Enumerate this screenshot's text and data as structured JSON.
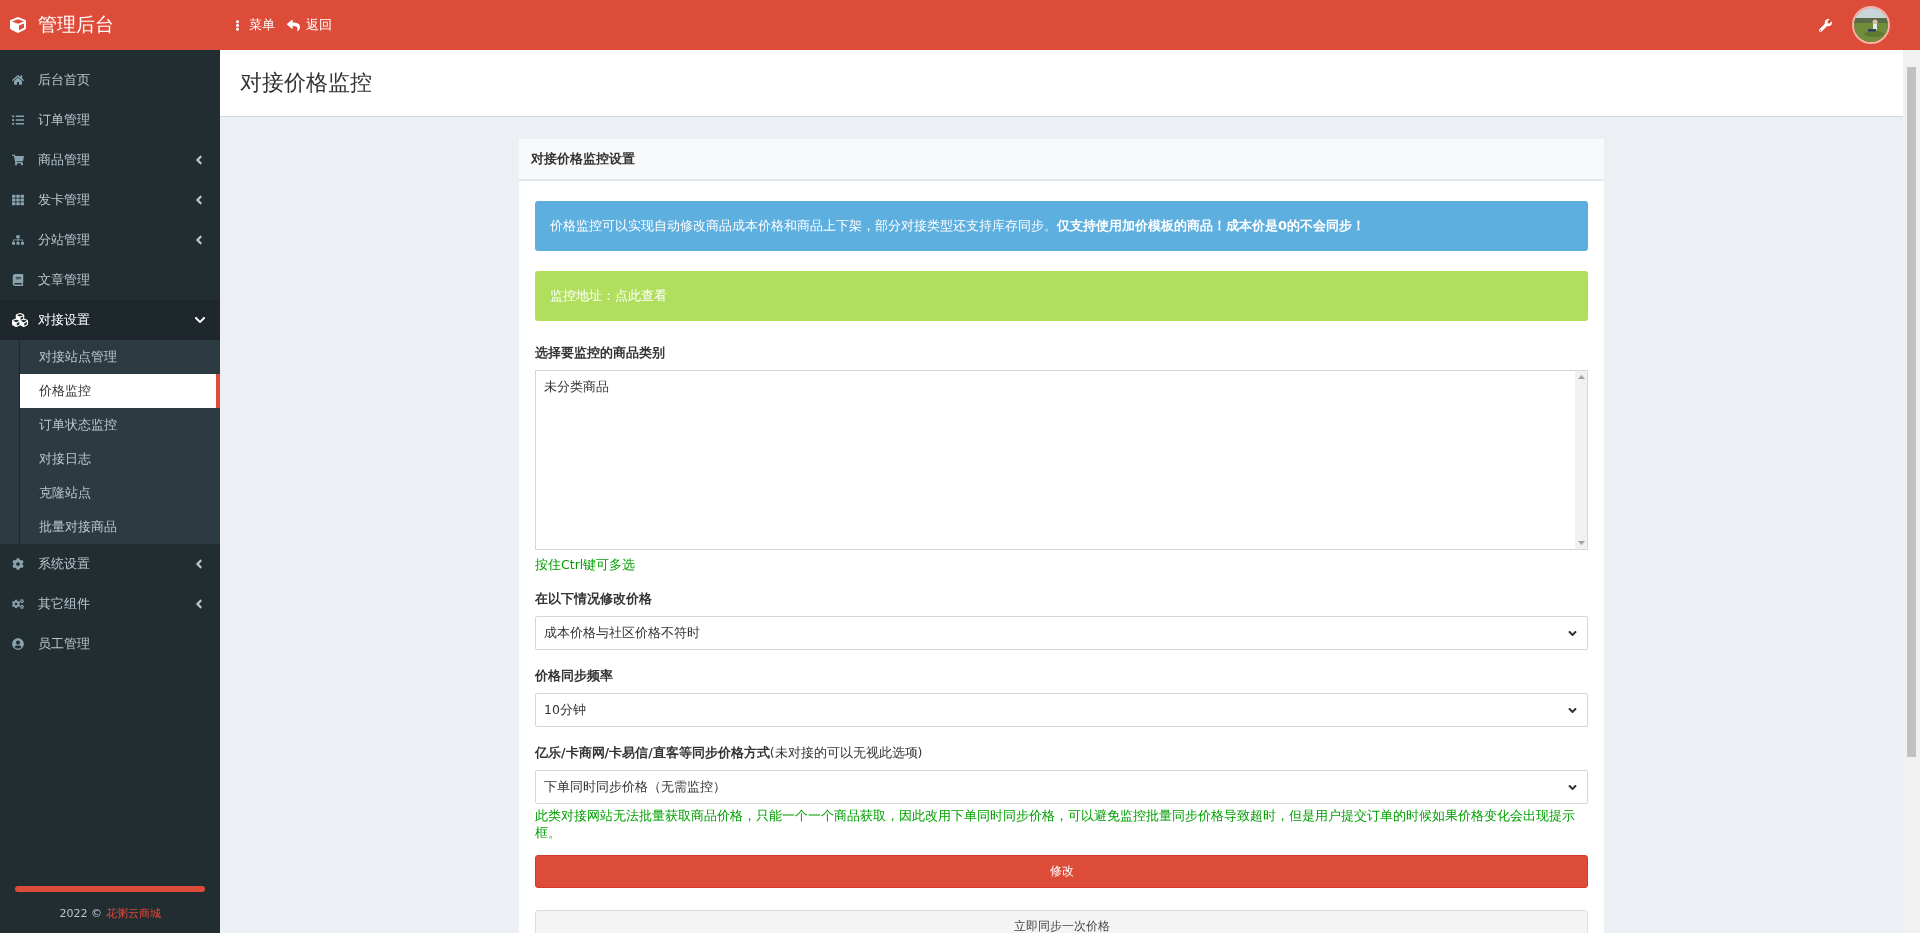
{
  "topbar": {
    "brand": "管理后台",
    "actions": [
      {
        "kind": "menu",
        "label": "菜单"
      },
      {
        "kind": "back",
        "label": "返回"
      }
    ]
  },
  "sidebar": {
    "items": [
      {
        "label": "后台首页",
        "collapsible": false,
        "expanded": false
      },
      {
        "label": "订单管理",
        "collapsible": false,
        "expanded": false
      },
      {
        "label": "商品管理",
        "collapsible": true,
        "expanded": false
      },
      {
        "label": "发卡管理",
        "collapsible": true,
        "expanded": false
      },
      {
        "label": "分站管理",
        "collapsible": true,
        "expanded": false
      },
      {
        "label": "文章管理",
        "collapsible": false,
        "expanded": false
      },
      {
        "label": "对接设置",
        "collapsible": true,
        "expanded": true,
        "children": [
          {
            "label": "对接站点管理",
            "selected": false
          },
          {
            "label": "价格监控",
            "selected": true
          },
          {
            "label": "订单状态监控",
            "selected": false
          },
          {
            "label": "对接日志",
            "selected": false
          },
          {
            "label": "克隆站点",
            "selected": false
          },
          {
            "label": "批量对接商品",
            "selected": false
          }
        ]
      },
      {
        "label": "系统设置",
        "collapsible": true,
        "expanded": false
      },
      {
        "label": "其它组件",
        "collapsible": true,
        "expanded": false
      },
      {
        "label": "员工管理",
        "collapsible": false,
        "expanded": false
      }
    ],
    "footer": {
      "year": "2022 ©",
      "link": "花粥云商城"
    }
  },
  "page_title": "对接价格监控",
  "card": {
    "title": "对接价格监控设置",
    "alerts": [
      {
        "kind": "info",
        "text": "价格监控可以实现自动修改商品成本价格和商品上下架，部分对接类型还支持库存同步。**仅支持使用加价模板的商品！成本价是0的不会同步！**"
      },
      {
        "kind": "success",
        "text": "监控地址：",
        "link": "点此查看"
      }
    ],
    "fields": [
      {
        "kind": "multiselect",
        "label": "选择要监控的商品类别",
        "options": [
          "未分类商品"
        ],
        "help": "按住Ctrl键可多选"
      },
      {
        "kind": "select",
        "label": "在以下情况修改价格",
        "value": "成本价格与社区价格不符时"
      },
      {
        "kind": "select",
        "label": "价格同步频率",
        "value": "10分钟"
      },
      {
        "kind": "select",
        "label": "**亿乐/卡商网/卡易信/直客等同步价格方式**(未对接的可以无视此选项)",
        "value": "下单同时同步价格（无需监控）",
        "help": "此类对接网站无法批量获取商品价格，只能一个一个商品获取，因此改用下单同时同步价格，可以避免监控批量同步价格导致超时，但是用户提交订单的时候如果价格变化会出现提示框。"
      }
    ],
    "buttons": [
      {
        "kind": "primary",
        "label": "修改"
      },
      {
        "kind": "default",
        "label": "立即同步一次价格"
      }
    ]
  }
}
